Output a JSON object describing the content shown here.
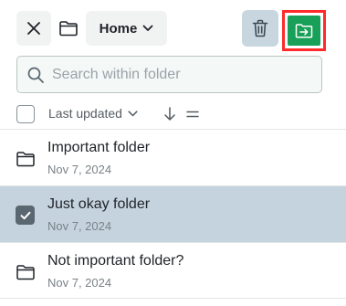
{
  "toolbar": {
    "close_icon": "close-icon",
    "folder_icon": "folder-icon",
    "location_label": "Home",
    "dropdown_icon": "chevron-down-icon",
    "delete_icon": "trash-icon",
    "move_icon": "move-to-folder-icon",
    "move_button_color": "#18a058",
    "highlight_color": "#ff2a2a"
  },
  "search": {
    "placeholder": "Search within folder",
    "value": ""
  },
  "sort": {
    "selected": "Last updated",
    "direction_icon": "arrow-down-icon",
    "menu_icon": "equals-icon"
  },
  "items": [
    {
      "name": "Important folder",
      "date": "Nov 7, 2024",
      "selected": false
    },
    {
      "name": "Just okay folder",
      "date": "Nov 7, 2024",
      "selected": true
    },
    {
      "name": "Not important folder?",
      "date": "Nov 7, 2024",
      "selected": false
    }
  ],
  "colors": {
    "selected_row": "#c5d3de",
    "delete_button": "#c8d6e0"
  }
}
